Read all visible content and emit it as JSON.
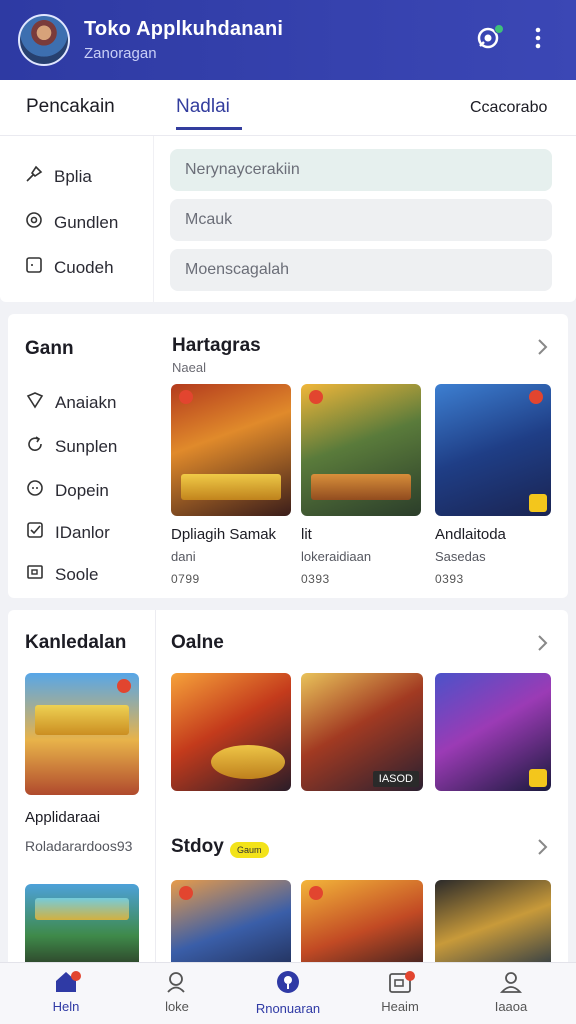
{
  "header": {
    "title": "Toko Applkuhdanani",
    "subtitle": "Zanoragan",
    "notification_icon": "notification-icon",
    "menu_icon": "more-vert-icon"
  },
  "tabs": [
    {
      "label": "Pencakain",
      "active": false
    },
    {
      "label": "Nadlai",
      "active": true
    },
    {
      "label": "Ccacorabo",
      "active": false
    }
  ],
  "menu1": [
    {
      "label": "Bplia",
      "icon": "tool-icon"
    },
    {
      "label": "Gundlen",
      "icon": "settings-icon"
    },
    {
      "label": "Cuodeh",
      "icon": "square-icon"
    }
  ],
  "fields": [
    {
      "placeholder": "Nerynaycerakiin"
    },
    {
      "placeholder": "Mcauk"
    },
    {
      "placeholder": "Moenscagalah"
    }
  ],
  "panel2": {
    "side_title": "Gann",
    "side_items": [
      {
        "label": "Anaiakn",
        "icon": "shield-icon"
      },
      {
        "label": "Sunplen",
        "icon": "refresh-icon"
      },
      {
        "label": "Dopein",
        "icon": "chat-icon"
      },
      {
        "label": "IDanlor",
        "icon": "checkbox-icon"
      },
      {
        "label": "Soole",
        "icon": "image-icon"
      }
    ],
    "section_title": "Hartagras",
    "section_sub": "Naeal",
    "cards": [
      {
        "name": "Dpliagih Samak",
        "meta": "dani",
        "price": "0799"
      },
      {
        "name": "lit",
        "meta": "lokeraidiaan",
        "price": "0393"
      },
      {
        "name": "Andlaitoda",
        "meta": "Sasedas",
        "price": "0393"
      }
    ]
  },
  "panel3": {
    "side_title": "Kanledalan",
    "side_card": {
      "name": "Applidaraai",
      "meta": "Roladarardoos93"
    },
    "section1_title": "Oalne",
    "section2_title": "Stdoy",
    "section2_badge": "Gaum",
    "cards1": [
      {},
      {
        "caption": "IASOD"
      },
      {}
    ]
  },
  "bottom_nav": [
    {
      "label": "Heln",
      "icon": "home-icon",
      "active": true,
      "badge": true
    },
    {
      "label": "loke",
      "icon": "search-user-icon",
      "active": false,
      "badge": false
    },
    {
      "label": "Rnonuaran",
      "icon": "location-icon",
      "active": true,
      "badge": false
    },
    {
      "label": "Heaim",
      "icon": "calendar-icon",
      "active": false,
      "badge": true
    },
    {
      "label": "Iaaoa",
      "icon": "profile-icon",
      "active": false,
      "badge": false
    }
  ],
  "colors": {
    "accent": "#333d9e",
    "appbar": "#3b47b5",
    "badge": "#f3e31a"
  }
}
